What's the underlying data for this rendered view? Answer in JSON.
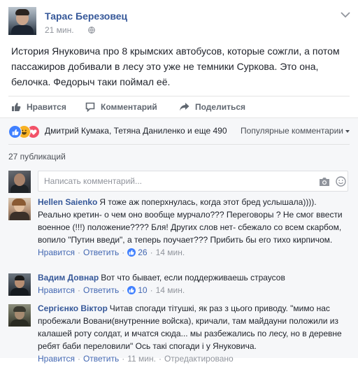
{
  "post": {
    "author": "Тарас Березовец",
    "time": "21 мин.",
    "text": "История Януковича про 8 крымских автобусов, которые сожгли, а потом пассажиров добивали в лесу это уже не темники Суркова. Это она, белочка. Федорыч таки поймал её."
  },
  "actions": {
    "like": "Нравится",
    "comment": "Комментарий",
    "share": "Поделиться"
  },
  "reactions": {
    "names": "Дмитрий Кумака, Тетяна Даниленко и еще 490",
    "sort": "Популярные комментарии"
  },
  "publications": "27 публикаций",
  "composer": {
    "placeholder": "Написать комментарий..."
  },
  "comments": [
    {
      "author": "Hellen Saienko",
      "text": "Я тоже аж поперхнулась, когда этот бред услышала)))). Реально кретин- о чем оно вообще мурчало??? Переговоры ? Не смог ввести военное (!!!) положение???? Бля! Других слов нет- сбежало со всем скарбом, вопило \"Путин введи\", а теперь поучает??? Прибить бы его тихо кирпичом.",
      "like": "Нравится",
      "reply": "Ответить",
      "count": "26",
      "time": "14 мин."
    },
    {
      "author": "Вадим Довнар",
      "text": "Вот что бывает, если поддерживаешь страусов",
      "like": "Нравится",
      "reply": "Ответить",
      "count": "10",
      "time": "14 мин."
    },
    {
      "author": "Сергієнко Віктор",
      "text": "Читав спогади тітушкі, як раз з цього приводу. \"мимо нас пробежали Вовани(внутренние войска), кричали, там майдауни положили из калашей роту солдат, и мчатся сюда... мы разбежались по лесу, но в деревне ребят баби переловили\" Ось такі спогади і у Януковича.",
      "like": "Нравится",
      "reply": "Ответить",
      "time": "11 мин.",
      "edited": "Отредактировано"
    }
  ],
  "colors": {
    "link": "#365899",
    "accent": "#4267b2",
    "muted": "#90949c",
    "like_blue": "#4080ff",
    "haha_yellow": "#f7b125"
  }
}
